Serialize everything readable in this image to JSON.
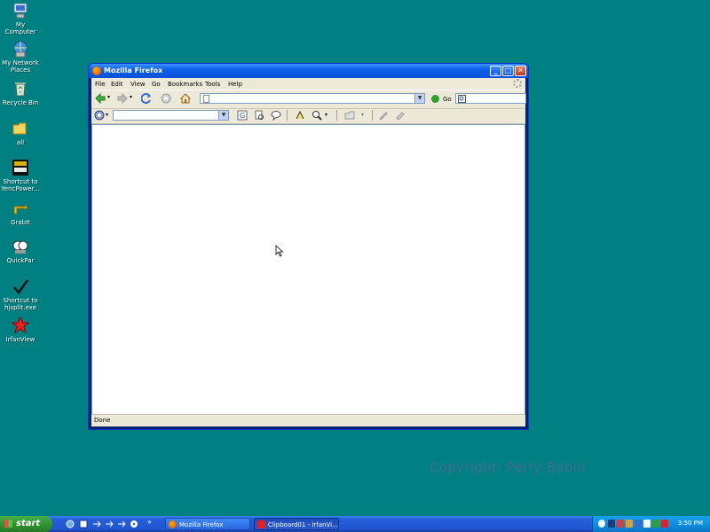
{
  "desktop": {
    "icons": [
      {
        "label": "My Computer",
        "icon": "my-computer-icon"
      },
      {
        "label": "My Network Places",
        "icon": "network-places-icon"
      },
      {
        "label": "Recycle Bin",
        "icon": "recycle-bin-icon"
      },
      {
        "label": "all",
        "icon": "folder-icon"
      },
      {
        "label": "Shortcut to YencPower...",
        "icon": "yencpower-icon"
      },
      {
        "label": "GrabIt",
        "icon": "grabit-icon"
      },
      {
        "label": "QuickPar",
        "icon": "quickpar-icon"
      },
      {
        "label": "Shortcut to hjsplit.exe",
        "icon": "hjsplit-icon"
      },
      {
        "label": "IrfanView",
        "icon": "irfanview-icon"
      }
    ],
    "watermark": "Copyright: Perry Babin"
  },
  "window": {
    "title": "Mozilla Firefox",
    "menu": [
      "File",
      "Edit",
      "View",
      "Go",
      "Bookmarks",
      "Tools",
      "Help"
    ],
    "address_value": "",
    "go_label": "Go",
    "search_value": "",
    "toolbar2_combo_value": "",
    "status": "Done"
  },
  "taskbar": {
    "start_label": "start",
    "tasks": [
      {
        "label": "Mozilla Firefox",
        "active": false
      },
      {
        "label": "Clipboard01 - IrfanVi...",
        "active": true
      }
    ],
    "clock": "3:50 PM"
  },
  "colors": {
    "desktop_bg": "#008080",
    "title_blue": "#0a5fe8",
    "taskbar_blue": "#245edb",
    "start_green": "#2f8f2f"
  }
}
